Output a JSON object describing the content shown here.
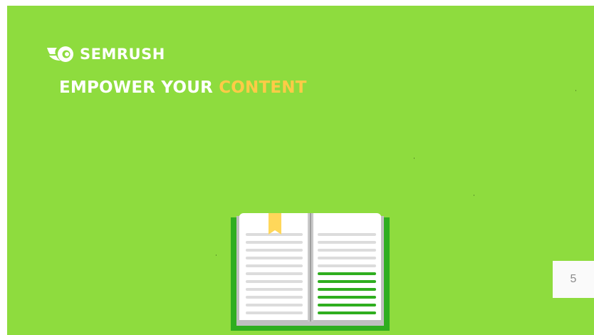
{
  "brand": {
    "name": "SEMRUSH",
    "logo_icon": "semrush-fireball-icon"
  },
  "headline": {
    "part1": "EMPOWER YOUR",
    "accent": "CONTENT"
  },
  "illustration": {
    "icon": "open-book-icon",
    "bookmark_icon": "bookmark-icon"
  },
  "page_number": "5",
  "colors": {
    "slide_background": "#8edc3e",
    "accent": "#ffcb47",
    "book_cover": "#2fae1f",
    "highlight_lines": "#2fae1f"
  }
}
